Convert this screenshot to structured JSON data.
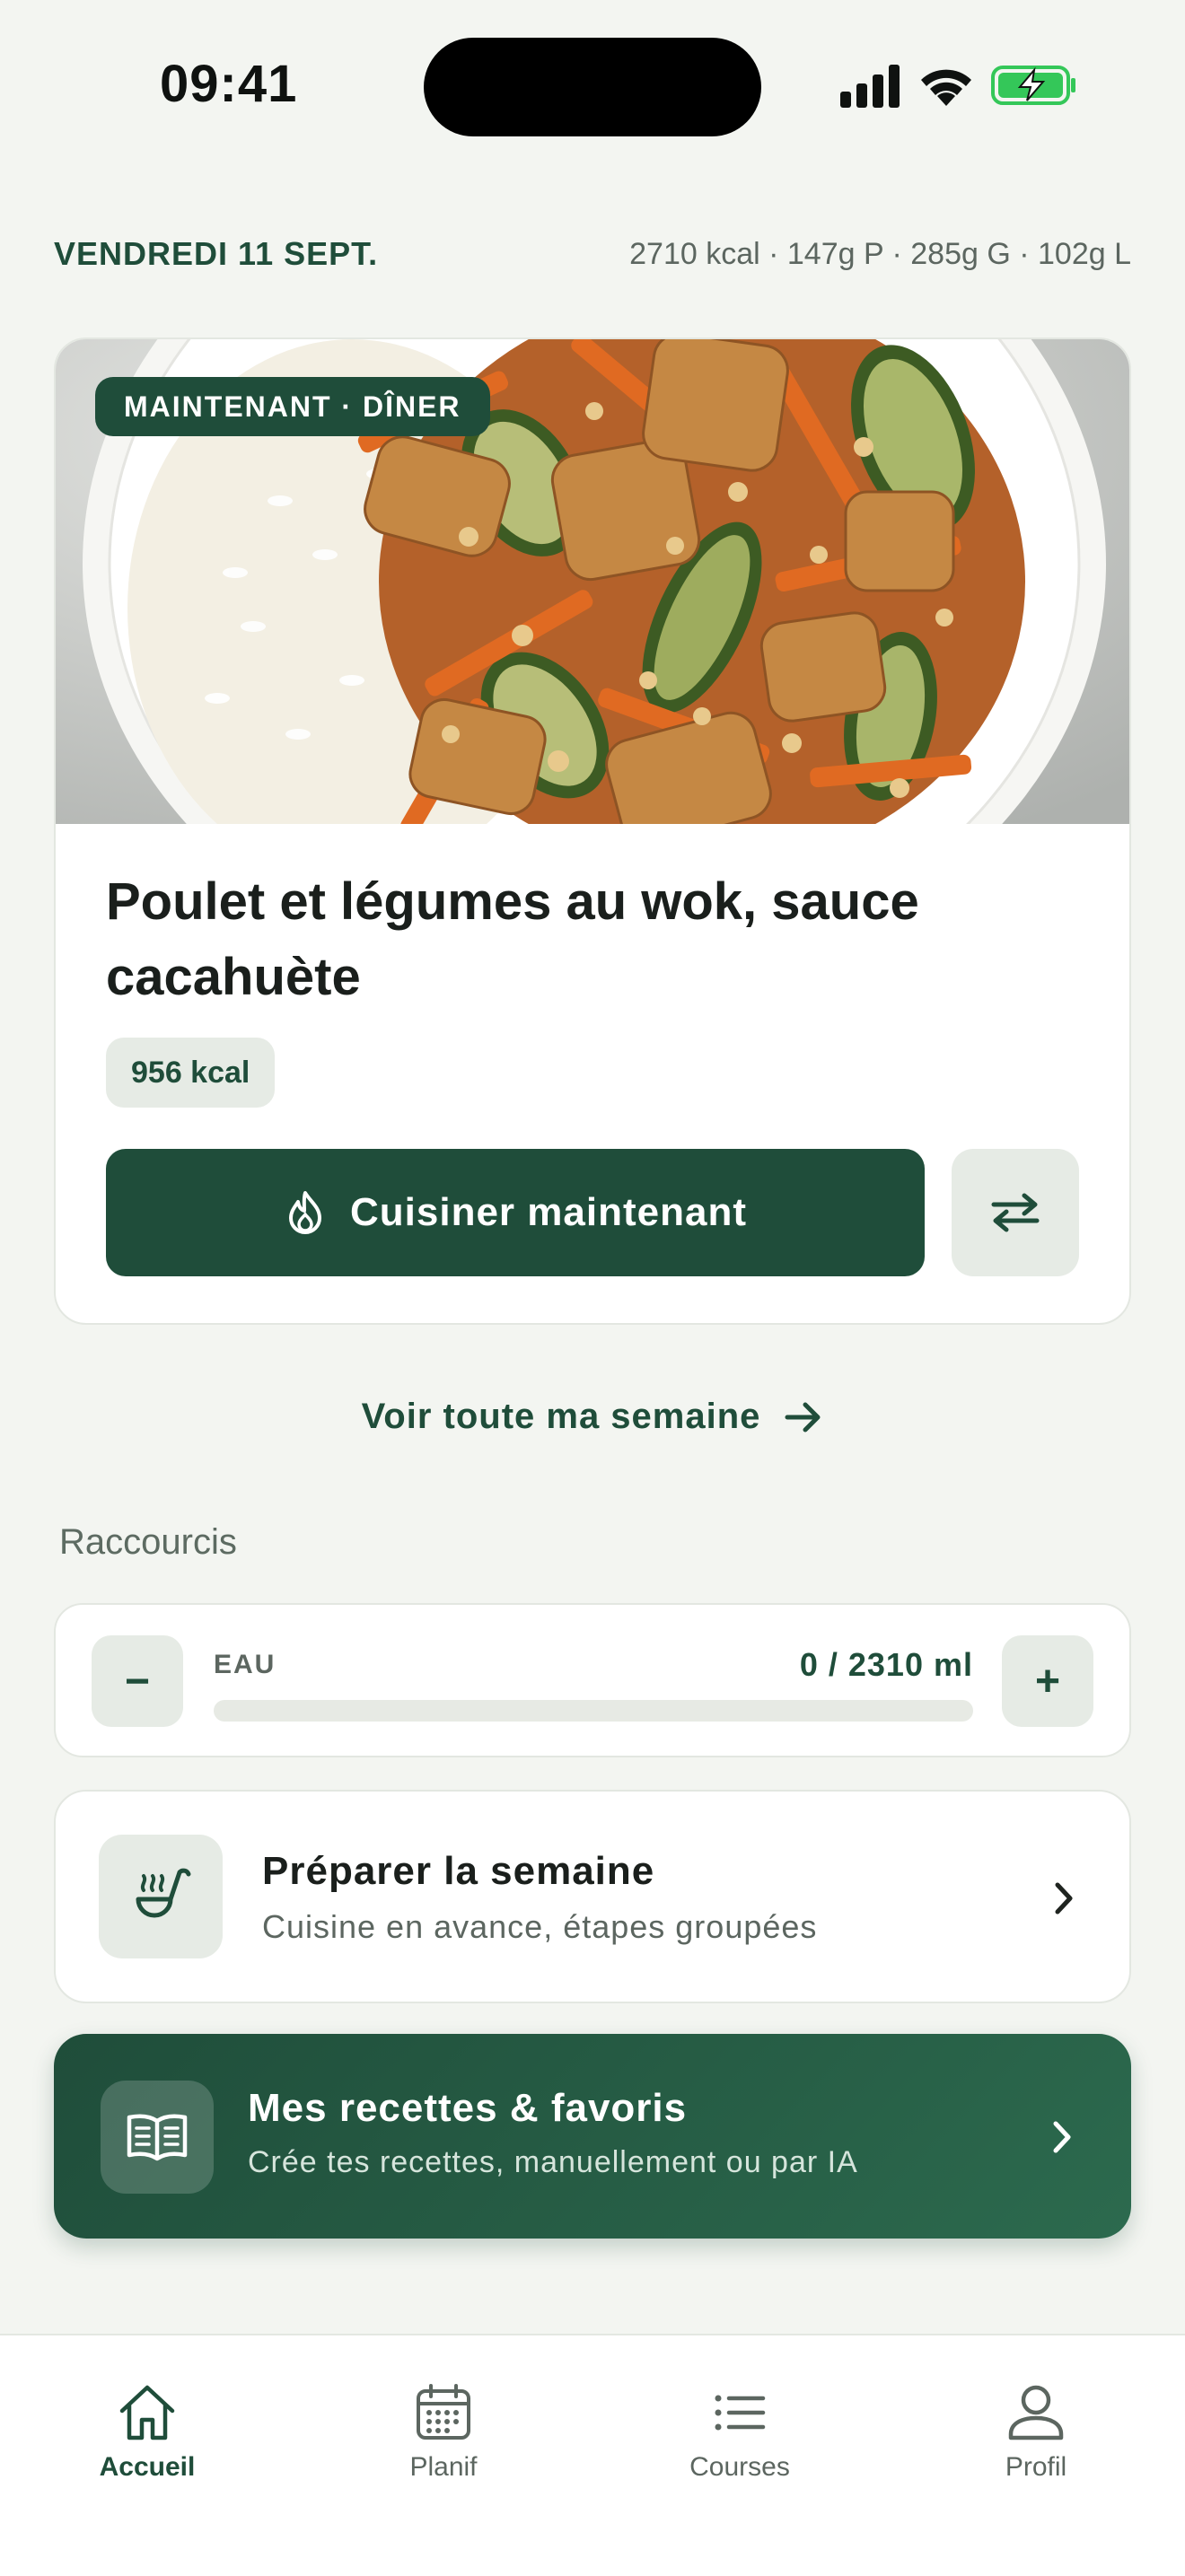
{
  "status_bar": {
    "time": "09:41"
  },
  "header": {
    "date": "VENDREDI 11 SEPT.",
    "macros": "2710 kcal · 147g P · 285g G · 102g L"
  },
  "meal": {
    "badge": "MAINTENANT · DÎNER",
    "title": "Poulet et légumes au wok, sauce cacahuète",
    "kcal": "956 kcal",
    "cook_label": "Cuisiner maintenant"
  },
  "week_link": "Voir toute ma semaine",
  "shortcuts": {
    "title": "Raccourcis",
    "water": {
      "label": "EAU",
      "value": "0 / 2310 ml",
      "minus": "−",
      "plus": "+",
      "progress_fraction": 0
    },
    "prep": {
      "title": "Préparer la semaine",
      "subtitle": "Cuisine en avance, étapes groupées"
    },
    "recipes": {
      "title": "Mes recettes & favoris",
      "subtitle": "Crée tes recettes, manuellement ou par IA"
    }
  },
  "tabs": [
    {
      "label": "Accueil",
      "icon": "home-icon",
      "active": true
    },
    {
      "label": "Planif",
      "icon": "calendar-icon",
      "active": false
    },
    {
      "label": "Courses",
      "icon": "list-icon",
      "active": false
    },
    {
      "label": "Profil",
      "icon": "user-icon",
      "active": false
    }
  ],
  "colors": {
    "brand": "#1F4D3A",
    "background": "#F3F5F1",
    "chip": "#E6EBE5",
    "battery": "#34C759"
  }
}
